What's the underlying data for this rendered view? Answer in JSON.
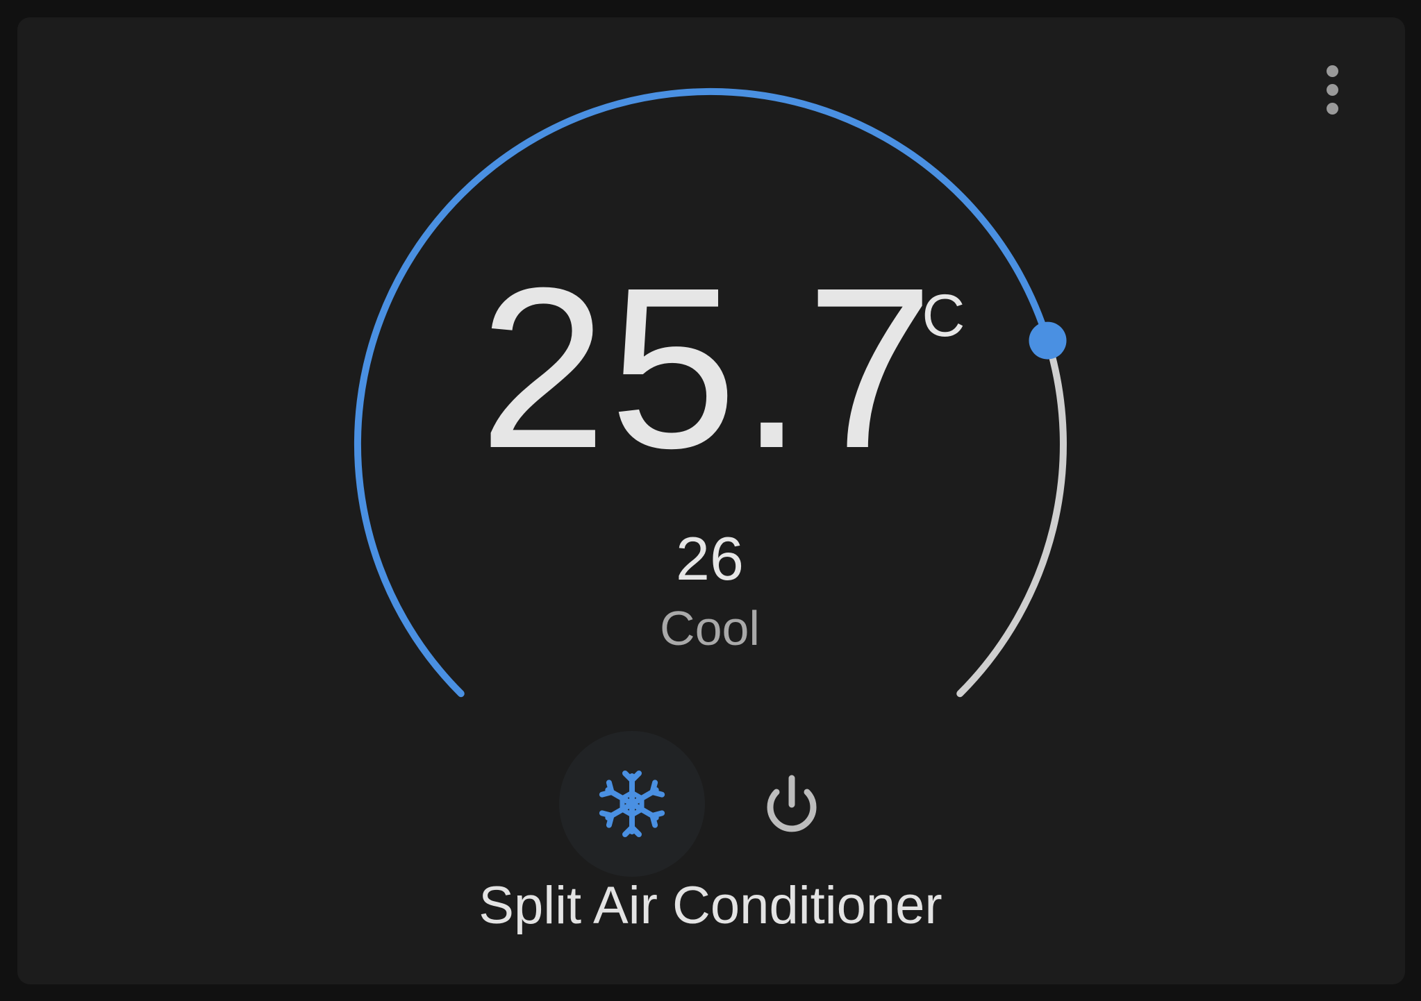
{
  "thermostat": {
    "current_temperature": "25.7",
    "unit": "°C",
    "target_temperature": "26",
    "mode_label": "Cool",
    "device_name": "Split Air Conditioner",
    "target_fraction": 0.77
  },
  "controls": {
    "cool_mode_icon": "snowflake-icon",
    "power_icon": "power-icon",
    "menu_icon": "more-vertical-icon"
  },
  "colors": {
    "accent": "#4a90e2",
    "track": "#cfcfcf",
    "background": "#1c1c1c"
  }
}
